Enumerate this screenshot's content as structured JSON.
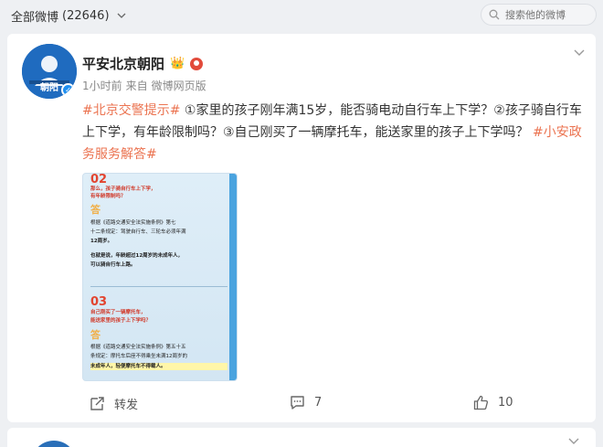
{
  "topbar": {
    "all_weibo_label": "全部微博",
    "all_weibo_count": "(22646)",
    "search_placeholder": "搜索他的微博"
  },
  "post": {
    "avatar_text": "朝阳",
    "username": "平安北京朝阳",
    "time": "1小时前",
    "source_prefix": "来自",
    "source": "微博网页版",
    "hashtag_1": "#北京交警提示#",
    "body_text": "①家里的孩子刚年满15岁，能否骑电动自行车上下学？②孩子骑自行车上下学，有年龄限制吗？③自己刚买了一辆摩托车，能送家里的孩子上下学吗？",
    "hashtag_2": "#小安政务服务解答#",
    "image": {
      "num_2": "02",
      "q2_line1": "那么，孩子骑自行车上下学，",
      "q2_line2": "有年龄限制吗？",
      "ans_mark_1": "答",
      "a2_line1": "根据《道路交通安全法实施条例》第七",
      "a2_line2": "十二条规定：驾驶自行车、三轮车必须年满",
      "a2_line3": "12周岁。",
      "a2_line4": "也就是说，年龄超过12周岁的未成年人，",
      "a2_line5": "可以骑自行车上路。",
      "num_3": "03",
      "q3_line1": "自己刚买了一辆摩托车，",
      "q3_line2": "能送家里的孩子上下学吗？",
      "ans_mark_2": "答",
      "a3_line1": "根据《道路交通安全法实施条例》第五十五",
      "a3_line2": "条规定：摩托车后座不得乘坐未满12周岁的",
      "a3_line3": "未成年人，轻便摩托车不得载人。"
    },
    "actions": {
      "repost_label": "转发",
      "comment_count": "7",
      "like_count": "10"
    }
  }
}
